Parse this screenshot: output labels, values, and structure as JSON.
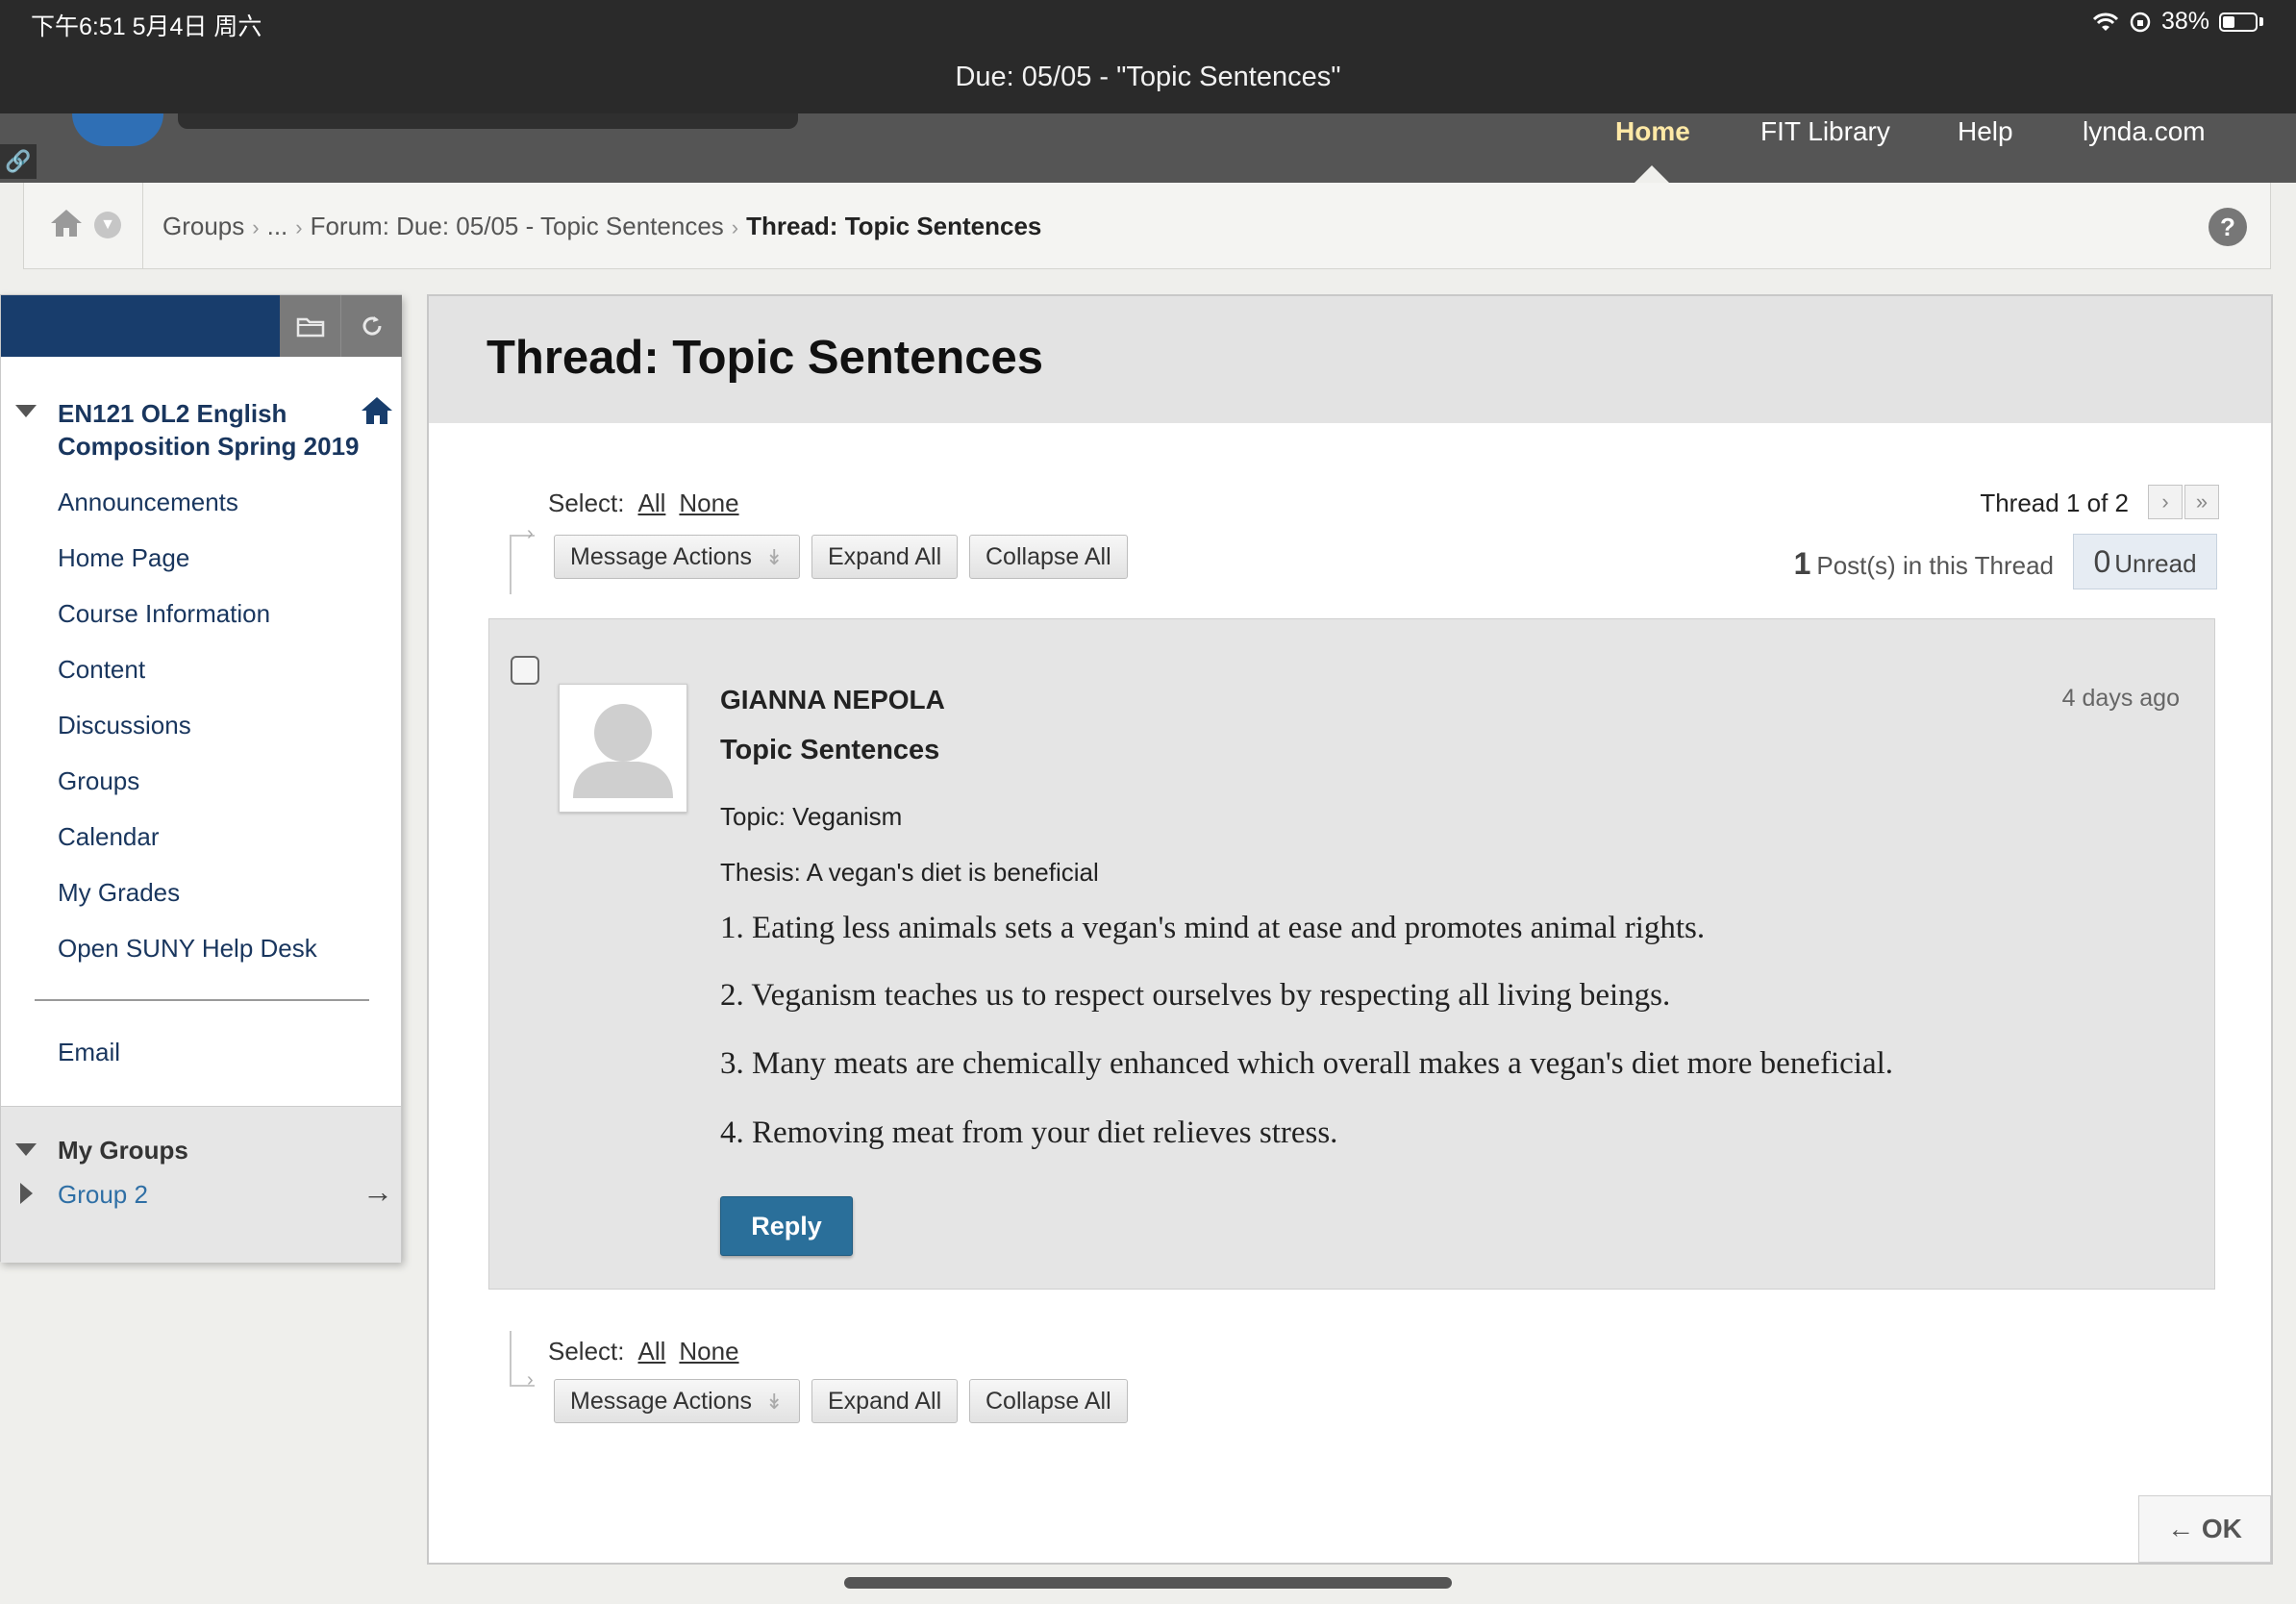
{
  "status_bar": {
    "time": "下午6:51   5月4日 周六",
    "battery": "38%"
  },
  "document_title": "Due: 05/05 - \"Topic Sentences\"",
  "nav": {
    "home": "Home",
    "library": "FIT Library",
    "help": "Help",
    "lynda": "lynda.com"
  },
  "breadcrumb": {
    "items": [
      "Groups",
      "...",
      "Forum: Due: 05/05 - Topic Sentences"
    ],
    "current": "Thread: Topic Sentences",
    "help": "?"
  },
  "course_menu": {
    "title": "EN121 OL2 English Composition Spring 2019",
    "items": [
      "Announcements",
      "Home Page",
      "Course Information",
      "Content",
      "Discussions",
      "Groups",
      "Calendar",
      "My Grades",
      "Open SUNY Help Desk"
    ],
    "email": "Email",
    "my_groups": "My Groups",
    "group": "Group 2",
    "group_arrow": "→"
  },
  "page": {
    "title": "Thread: Topic Sentences"
  },
  "toolbar": {
    "select_label": "Select:",
    "all": "All",
    "none": "None",
    "message_actions": "Message Actions",
    "expand_all": "Expand All",
    "collapse_all": "Collapse All"
  },
  "thread_info": {
    "position": "Thread 1 of 2",
    "post_count": "1",
    "post_count_label": "Post(s) in this Thread",
    "unread_count": "0",
    "unread_label": "Unread"
  },
  "post": {
    "author": "GIANNA NEPOLA",
    "time": "4 days ago",
    "subject": "Topic Sentences",
    "topic": "Topic: Veganism",
    "thesis": "Thesis: A vegan's diet is beneficial",
    "lines": [
      "1. Eating less animals sets a vegan's mind at ease and promotes animal rights.",
      "2. Veganism teaches us to respect ourselves by respecting all living beings.",
      "3. Many meats are chemically enhanced which overall makes a vegan's diet more beneficial.",
      "4. Removing meat from your diet relieves stress."
    ],
    "reply": "Reply"
  },
  "ok_button": "OK",
  "ok_arrow": "←",
  "colors": {
    "nav_active": "#ffe9a6",
    "menu_header": "#183d6c",
    "link": "#19365e",
    "reply": "#2a6f9a"
  }
}
